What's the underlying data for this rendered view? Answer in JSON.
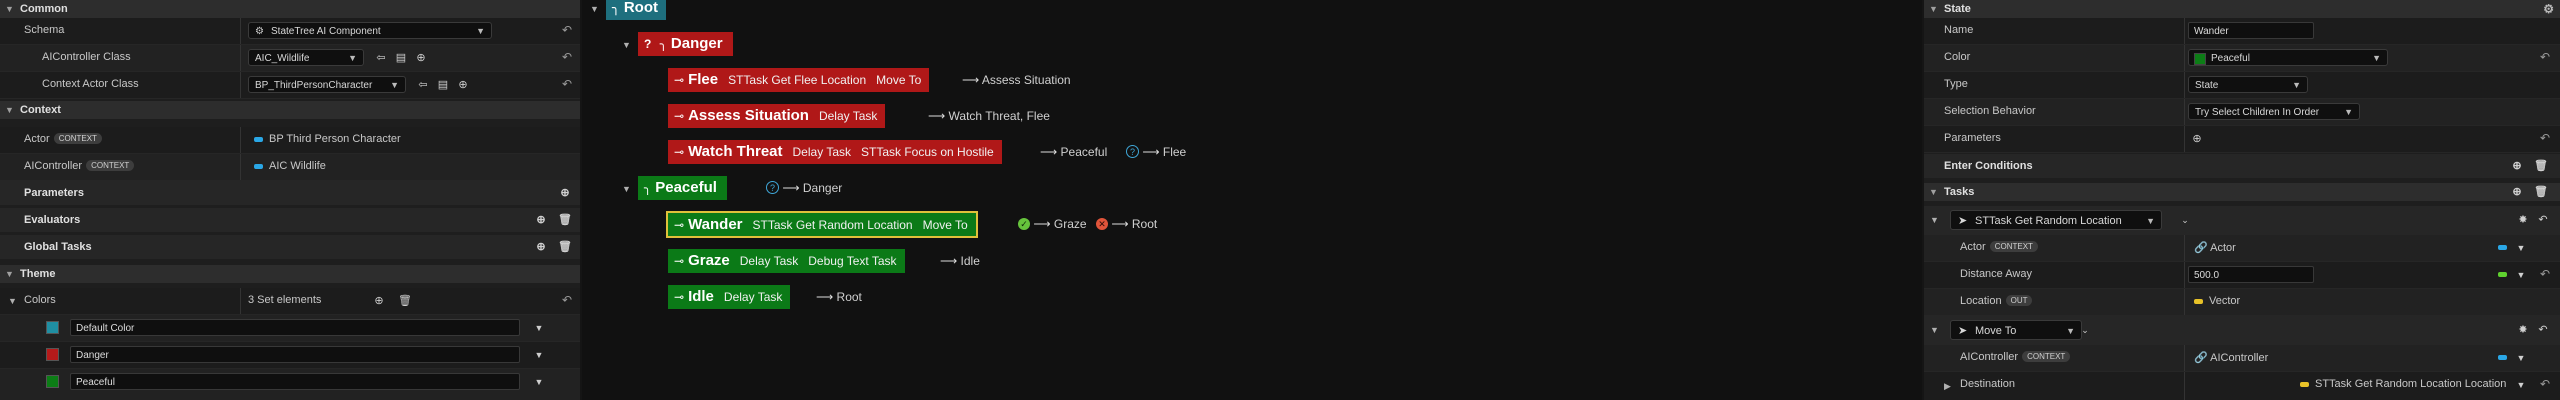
{
  "left": {
    "common": {
      "header": "Common",
      "schema": {
        "label": "Schema",
        "value": "StateTree AI Component"
      },
      "ai_controller_class": {
        "label": "AIController Class",
        "value": "AIC_Wildlife"
      },
      "context_actor_class": {
        "label": "Context Actor Class",
        "value": "BP_ThirdPersonCharacter"
      }
    },
    "context": {
      "header": "Context",
      "actor": {
        "label": "Actor",
        "badge": "CONTEXT",
        "value": "BP Third Person Character"
      },
      "ai_controller": {
        "label": "AIController",
        "badge": "CONTEXT",
        "value": "AIC Wildlife"
      }
    },
    "parameters": "Parameters",
    "evaluators": "Evaluators",
    "global_tasks": "Global Tasks",
    "theme": {
      "header": "Theme",
      "colors": {
        "label": "Colors",
        "count": "3 Set elements"
      },
      "items": [
        {
          "name": "Default Color",
          "color": "#1f8fa3"
        },
        {
          "name": "Danger",
          "color": "#b51a1a"
        },
        {
          "name": "Peaceful",
          "color": "#0c7d16"
        }
      ]
    }
  },
  "tree": {
    "root": {
      "name": "Root",
      "color": "#1e6f7e"
    },
    "danger": {
      "name": "Danger",
      "transition": "Danger"
    },
    "flee": {
      "name": "Flee",
      "tasks": [
        "STTask Get Flee Location",
        "Move To"
      ],
      "transition": "Assess Situation"
    },
    "assess": {
      "name": "Assess Situation",
      "tasks": [
        "Delay Task"
      ],
      "transition": "Watch Threat, Flee"
    },
    "watch": {
      "name": "Watch Threat",
      "tasks": [
        "Delay Task",
        "STTask Focus on Hostile"
      ],
      "transition1": "Peaceful",
      "transition2": "Flee"
    },
    "peaceful": {
      "name": "Peaceful",
      "transition": "Danger"
    },
    "wander": {
      "name": "Wander",
      "tasks": [
        "STTask Get Random Location",
        "Move To"
      ],
      "ok": "Graze",
      "fail": "Root"
    },
    "graze": {
      "name": "Graze",
      "tasks": [
        "Delay Task",
        "Debug Text Task"
      ],
      "transition": "Idle"
    },
    "idle": {
      "name": "Idle",
      "tasks": [
        "Delay Task"
      ],
      "transition": "Root"
    }
  },
  "right": {
    "state_header": "State",
    "name": {
      "label": "Name",
      "value": "Wander"
    },
    "color": {
      "label": "Color",
      "value": "Peaceful",
      "swatch": "#0c7d16"
    },
    "type": {
      "label": "Type",
      "value": "State"
    },
    "selection": {
      "label": "Selection Behavior",
      "value": "Try Select Children In Order"
    },
    "parameters": "Parameters",
    "enter_conditions": "Enter Conditions",
    "tasks_header": "Tasks",
    "task1": {
      "name": "STTask Get Random Location",
      "actor": {
        "label": "Actor",
        "badge": "CONTEXT",
        "value": "Actor"
      },
      "distance": {
        "label": "Distance Away",
        "value": "500.0"
      },
      "location": {
        "label": "Location",
        "badge": "OUT",
        "value": "Vector"
      }
    },
    "task2": {
      "name": "Move To",
      "ai_controller": {
        "label": "AIController",
        "badge": "CONTEXT",
        "value": "AIController"
      },
      "destination": {
        "label": "Destination",
        "value": "STTask Get Random Location"
      }
    }
  }
}
